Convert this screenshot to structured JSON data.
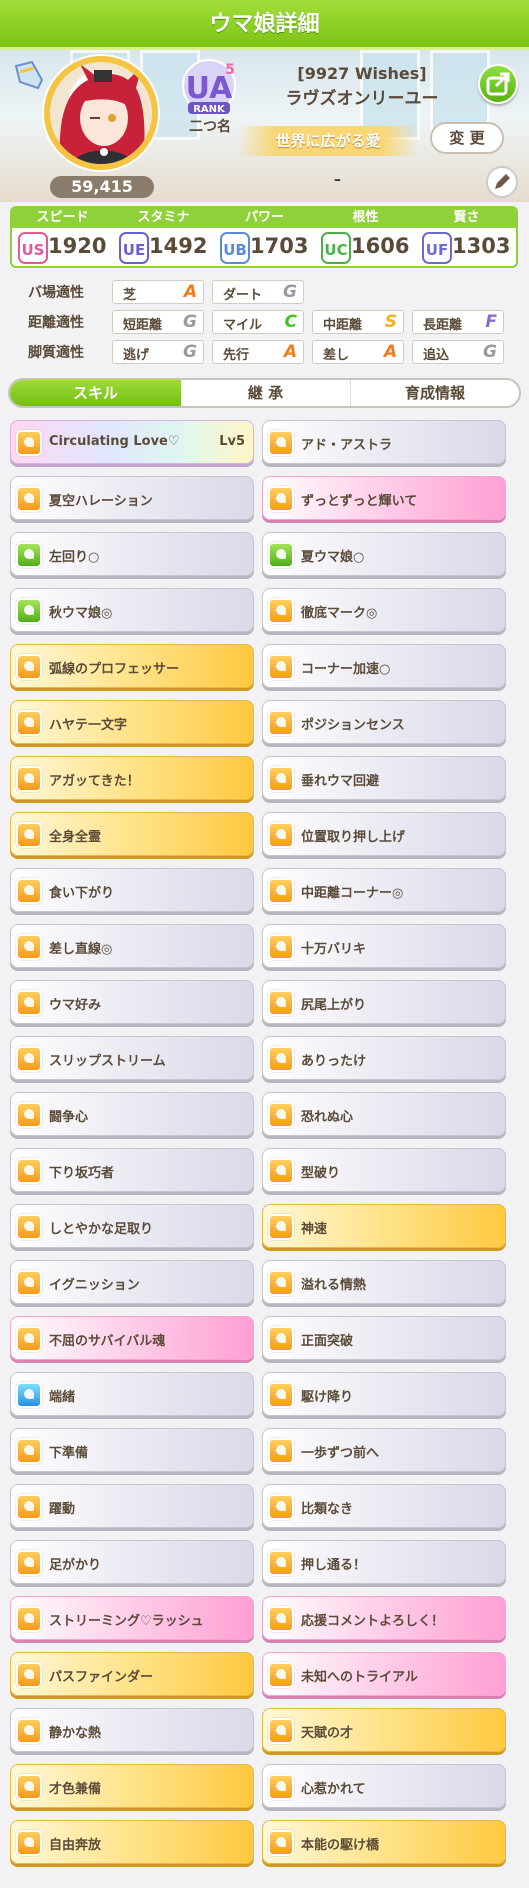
{
  "header": {
    "title": "ウマ娘詳細"
  },
  "profile": {
    "fans": "59,415",
    "rank_letter": "UA",
    "rank_sub": "5",
    "rank_word": "RANK",
    "rank_name": "二つ名",
    "title_bracket": "[9927 Wishes]",
    "name": "ラヴズオンリーユー",
    "epithet": "世界に広がる愛",
    "change_label": "変 更",
    "dash": "–"
  },
  "stats": [
    {
      "label": "スピード",
      "grade": "US",
      "value": "1920",
      "color": "#e05a9a"
    },
    {
      "label": "スタミナ",
      "grade": "UE",
      "value": "1492",
      "color": "#6a5fd6"
    },
    {
      "label": "パワー",
      "grade": "UB",
      "value": "1703",
      "color": "#5a8bd6"
    },
    {
      "label": "根性",
      "grade": "UC",
      "value": "1606",
      "color": "#4bb04b"
    },
    {
      "label": "賢さ",
      "grade": "UF",
      "value": "1303",
      "color": "#6d6bd0"
    }
  ],
  "aptitude": {
    "track": {
      "label": "バ場適性",
      "items": [
        {
          "name": "芝",
          "grade": "A"
        },
        {
          "name": "ダート",
          "grade": "G"
        }
      ]
    },
    "distance": {
      "label": "距離適性",
      "items": [
        {
          "name": "短距離",
          "grade": "G"
        },
        {
          "name": "マイル",
          "grade": "C"
        },
        {
          "name": "中距離",
          "grade": "S"
        },
        {
          "name": "長距離",
          "grade": "F"
        }
      ]
    },
    "style": {
      "label": "脚質適性",
      "items": [
        {
          "name": "逃げ",
          "grade": "G"
        },
        {
          "name": "先行",
          "grade": "A"
        },
        {
          "name": "差し",
          "grade": "A"
        },
        {
          "name": "追込",
          "grade": "G"
        }
      ]
    }
  },
  "grade_colors": {
    "A": "#f27b1a",
    "C": "#4cbb2a",
    "S": "#f2b01a",
    "F": "#8c6ad6",
    "G": "#9a9a9a"
  },
  "tabs": [
    "スキル",
    "継 承",
    "育成情報"
  ],
  "skills": [
    {
      "name": "Circulating Love♡",
      "lv": "Lv5",
      "style": "rainbow",
      "icon": "o"
    },
    {
      "name": "アド・アストラ",
      "style": "silver",
      "icon": "o"
    },
    {
      "name": "夏空ハレーション",
      "style": "silver",
      "icon": "o"
    },
    {
      "name": "ずっとずっと輝いて",
      "style": "pink",
      "icon": "o"
    },
    {
      "name": "左回り○",
      "style": "silver",
      "icon": "g"
    },
    {
      "name": "夏ウマ娘○",
      "style": "silver",
      "icon": "g"
    },
    {
      "name": "秋ウマ娘◎",
      "style": "silver",
      "icon": "g"
    },
    {
      "name": "徹底マーク◎",
      "style": "silver",
      "icon": "o"
    },
    {
      "name": "弧線のプロフェッサー",
      "style": "gold",
      "icon": "o"
    },
    {
      "name": "コーナー加速○",
      "style": "silver",
      "icon": "o"
    },
    {
      "name": "ハヤテ一文字",
      "style": "gold",
      "icon": "o"
    },
    {
      "name": "ポジションセンス",
      "style": "silver",
      "icon": "o"
    },
    {
      "name": "アガッてきた！",
      "style": "gold",
      "icon": "o"
    },
    {
      "name": "垂れウマ回避",
      "style": "silver",
      "icon": "o"
    },
    {
      "name": "全身全霊",
      "style": "gold",
      "icon": "o"
    },
    {
      "name": "位置取り押し上げ",
      "style": "silver",
      "icon": "o"
    },
    {
      "name": "食い下がり",
      "style": "silver",
      "icon": "o"
    },
    {
      "name": "中距離コーナー◎",
      "style": "silver",
      "icon": "o"
    },
    {
      "name": "差し直線◎",
      "style": "silver",
      "icon": "o"
    },
    {
      "name": "十万バリキ",
      "style": "silver",
      "icon": "o"
    },
    {
      "name": "ウマ好み",
      "style": "silver",
      "icon": "o"
    },
    {
      "name": "尻尾上がり",
      "style": "silver",
      "icon": "o"
    },
    {
      "name": "スリップストリーム",
      "style": "silver",
      "icon": "o"
    },
    {
      "name": "ありったけ",
      "style": "silver",
      "icon": "o"
    },
    {
      "name": "闘争心",
      "style": "silver",
      "icon": "o"
    },
    {
      "name": "恐れぬ心",
      "style": "silver",
      "icon": "o"
    },
    {
      "name": "下り坂巧者",
      "style": "silver",
      "icon": "o"
    },
    {
      "name": "型破り",
      "style": "silver",
      "icon": "o"
    },
    {
      "name": "しとやかな足取り",
      "style": "silver",
      "icon": "o"
    },
    {
      "name": "神速",
      "style": "gold",
      "icon": "o"
    },
    {
      "name": "イグニッション",
      "style": "silver",
      "icon": "o"
    },
    {
      "name": "溢れる情熱",
      "style": "silver",
      "icon": "o"
    },
    {
      "name": "不屈のサバイバル魂",
      "style": "pink",
      "icon": "o"
    },
    {
      "name": "正面突破",
      "style": "silver",
      "icon": "o"
    },
    {
      "name": "端緒",
      "style": "silver",
      "icon": "b"
    },
    {
      "name": "駆け降り",
      "style": "silver",
      "icon": "o"
    },
    {
      "name": "下準備",
      "style": "silver",
      "icon": "o"
    },
    {
      "name": "一歩ずつ前へ",
      "style": "silver",
      "icon": "o"
    },
    {
      "name": "躍動",
      "style": "silver",
      "icon": "o"
    },
    {
      "name": "比類なき",
      "style": "silver",
      "icon": "o"
    },
    {
      "name": "足がかり",
      "style": "silver",
      "icon": "o"
    },
    {
      "name": "押し通る！",
      "style": "silver",
      "icon": "o"
    },
    {
      "name": "ストリーミング♡ラッシュ",
      "style": "pink",
      "icon": "o"
    },
    {
      "name": "応援コメントよろしく！",
      "style": "pink",
      "icon": "o"
    },
    {
      "name": "パスファインダー",
      "style": "gold",
      "icon": "o"
    },
    {
      "name": "未知へのトライアル",
      "style": "pink",
      "icon": "o"
    },
    {
      "name": "静かな熱",
      "style": "silver",
      "icon": "o"
    },
    {
      "name": "天賦の才",
      "style": "gold",
      "icon": "o"
    },
    {
      "name": "才色兼備",
      "style": "gold",
      "icon": "o"
    },
    {
      "name": "心惹かれて",
      "style": "silver",
      "icon": "o"
    },
    {
      "name": "自由奔放",
      "style": "gold",
      "icon": "o"
    },
    {
      "name": "本能の駆け橋",
      "style": "gold",
      "icon": "o"
    }
  ]
}
